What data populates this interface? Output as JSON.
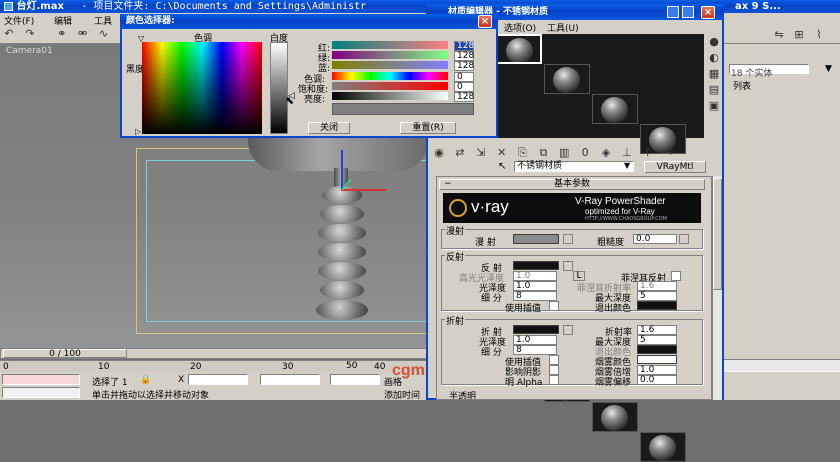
{
  "app": {
    "title_left": "台灯.max",
    "title_mid": "- 项目文件夹: C:\\Documents and Settings\\Administr",
    "title_right": "ax 9 S...",
    "menu": [
      "文件(F)",
      "编辑",
      "工具"
    ],
    "viewport_label": "Camera01",
    "frame_counter": "0 / 100",
    "timeline_ticks": [
      "0",
      "10",
      "20",
      "30",
      "40",
      "50"
    ],
    "status_selected": "选择了 1",
    "status_x_label": "X",
    "status_hint": "单击并拖动以选择并移动对象",
    "status_add": "添加时间",
    "status_grid": "画格",
    "right_panel_line1": "18 个实体",
    "right_panel_line2": "列表",
    "watermark": "cgm.com"
  },
  "color_picker": {
    "title": "颜色选择器:",
    "hue_label": "色调",
    "white_label": "白度",
    "black_label": "黑度",
    "red_label": "红:",
    "green_label": "绿:",
    "blue_label": "蓝:",
    "hue_row_label": "色调:",
    "sat_label": "饱和度:",
    "value_label": "亮度:",
    "red_value": "128",
    "green_value": "128",
    "blue_value": "128",
    "hue_value": "0",
    "sat_value": "0",
    "val_value": "128",
    "close_button": "关闭",
    "reset_button": "重置(R)",
    "current_color": "#808080"
  },
  "material_editor": {
    "title": "材质编辑器 - 不锈钢材质",
    "menu": [
      "材质(M)",
      "导航(N)",
      "选项(O)",
      "工具(U)"
    ],
    "material_name": "不锈钢材质",
    "material_type": "VRayMtl",
    "rollout_title": "基本参数",
    "vray_logo": "v·ray",
    "vray_product": "V-Ray PowerShader",
    "vray_tagline": "optimized for V-Ray",
    "vray_url": "HTTP://WWW.CHAOSGROUP.COM",
    "diffuse_section": "漫射",
    "diffuse_label": "漫 射",
    "roughness_label": "粗糙度",
    "roughness_value": "0.0",
    "reflect_section": "反射",
    "reflect_label": "反 射",
    "hilight_gloss_label": "高光光泽度",
    "hilight_gloss_value": "1.0",
    "lock_label": "L",
    "fresnel_label": "菲涅耳反射",
    "fresnel_ior_label": "菲涅耳折射率",
    "fresnel_ior_value": "1.6",
    "refl_gloss_label": "光泽度",
    "refl_gloss_value": "1.0",
    "max_depth_label": "最大深度",
    "max_depth_value": "5",
    "subdivs_label": "细 分",
    "subdivs_value": "8",
    "use_interp_label": "使用插值",
    "exit_color_label": "退出颜色",
    "refract_section": "折射",
    "refract_label": "折 射",
    "ior_label": "折射率",
    "ior_value": "1.6",
    "refr_gloss_label": "光泽度",
    "refr_gloss_value": "1.0",
    "refr_max_depth_label": "最大深度",
    "refr_max_depth_value": "5",
    "refr_subdivs_label": "细 分",
    "refr_subdivs_value": "8",
    "refr_exit_color_label": "退出颜色",
    "refr_use_interp_label": "使用插值",
    "fog_color_label": "烟雾颜色",
    "shadows_label": "影响阴影",
    "fog_mult_label": "烟雾倍增",
    "fog_mult_value": "1.0",
    "alpha_label": "明 Alpha",
    "fog_bias_label": "烟雾偏移",
    "fog_bias_value": "0.0",
    "translucency_section": "半透明"
  }
}
